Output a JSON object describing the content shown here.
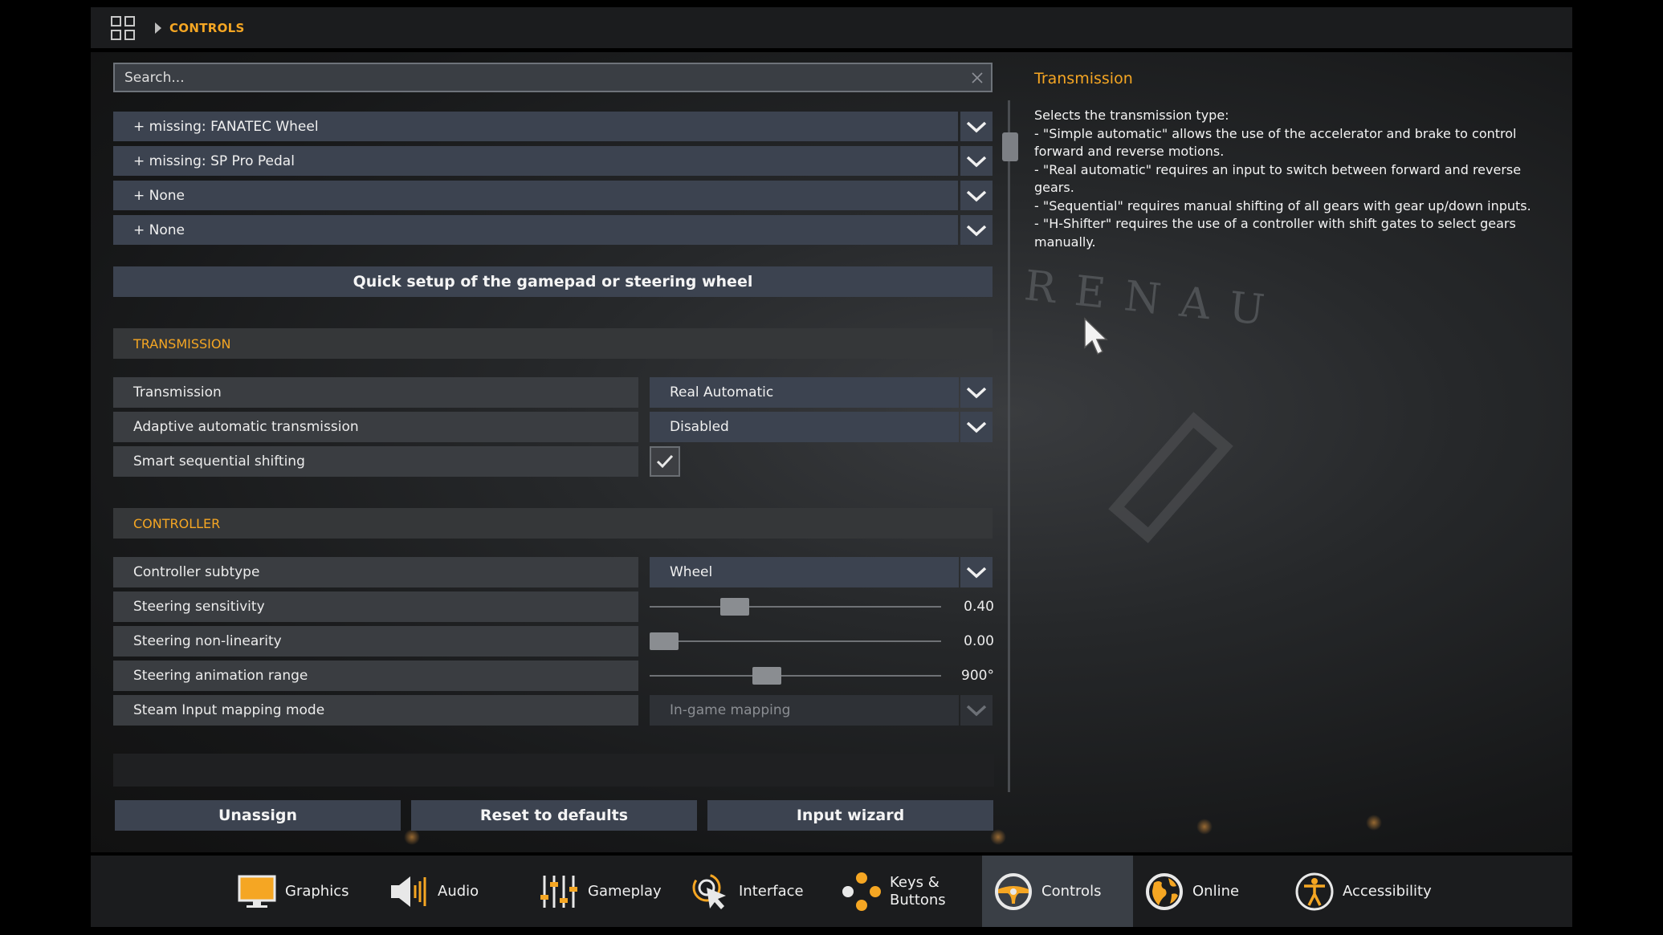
{
  "breadcrumb": {
    "current": "CONTROLS"
  },
  "search": {
    "placeholder": "Search..."
  },
  "devices": [
    {
      "label": "+ missing: FANATEC Wheel"
    },
    {
      "label": "+ missing: SP Pro Pedal"
    },
    {
      "label": "+ None"
    },
    {
      "label": "+ None"
    }
  ],
  "quick_setup_label": "Quick setup of the gamepad or steering wheel",
  "sections": {
    "transmission": {
      "title": "TRANSMISSION",
      "transmission": {
        "label": "Transmission",
        "value": "Real Automatic"
      },
      "adaptive": {
        "label": "Adaptive automatic transmission",
        "value": "Disabled"
      },
      "smart": {
        "label": "Smart sequential shifting",
        "checked": true
      }
    },
    "controller": {
      "title": "CONTROLLER",
      "subtype": {
        "label": "Controller subtype",
        "value": "Wheel"
      },
      "sensitivity": {
        "label": "Steering sensitivity",
        "value": "0.40",
        "level": 0.27
      },
      "nonlinearity": {
        "label": "Steering non-linearity",
        "value": "0.00",
        "level": 0.0
      },
      "anim_range": {
        "label": "Steering animation range",
        "value": "900°",
        "level": 0.39
      },
      "steam_input": {
        "label": "Steam Input mapping mode",
        "value": "In-game mapping",
        "disabled": true
      }
    }
  },
  "actions": {
    "unassign": "Unassign",
    "reset": "Reset to defaults",
    "wizard": "Input wizard"
  },
  "description": {
    "title": "Transmission",
    "body": "Selects the transmission type:\n- \"Simple automatic\" allows the use of the accelerator and brake to control forward and reverse motions.\n- \"Real automatic\" requires an input to switch between forward and reverse gears.\n- \"Sequential\" requires manual shifting of all gears with gear up/down inputs.\n- \"H-Shifter\" requires the use of a controller with shift gates to select gears manually."
  },
  "background": {
    "brand_text": "RENAU"
  },
  "nav": [
    {
      "label": "Graphics",
      "icon": "monitor-icon"
    },
    {
      "label": "Audio",
      "icon": "speaker-icon"
    },
    {
      "label": "Gameplay",
      "icon": "sliders-icon"
    },
    {
      "label": "Interface",
      "icon": "cursor-icon"
    },
    {
      "label": "Keys &\nButtons",
      "icon": "buttons-icon"
    },
    {
      "label": "Controls",
      "icon": "steering-wheel-icon",
      "active": true
    },
    {
      "label": "Online",
      "icon": "globe-icon"
    },
    {
      "label": "Accessibility",
      "icon": "accessibility-icon"
    }
  ],
  "colors": {
    "accent": "#f5a623",
    "button": "#3c4350",
    "panel": "#1b1c1e"
  }
}
